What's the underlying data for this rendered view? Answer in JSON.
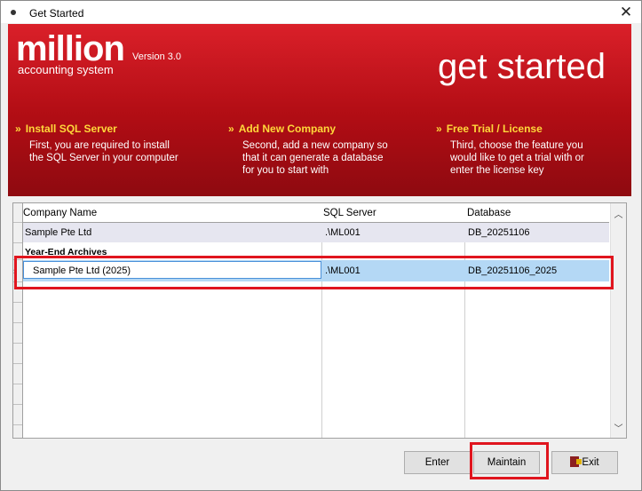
{
  "window": {
    "title": "Get Started",
    "close_glyph": "✕"
  },
  "banner": {
    "logo": "million",
    "logo_sub": "accounting system",
    "version": "Version 3.0",
    "tagline": "get started",
    "steps": [
      {
        "title": "Install SQL Server",
        "desc": "First, you are required to install\nthe SQL Server in your computer"
      },
      {
        "title": "Add New Company",
        "desc": "Second, add a new company so\nthat it can generate a database\nfor you to start with"
      },
      {
        "title": "Free Trial / License",
        "desc": "Third, choose the feature you\nwould like to get a trial with or\nenter the license key"
      }
    ],
    "chevron": "»"
  },
  "grid": {
    "columns": [
      "Company Name",
      "SQL Server",
      "Database"
    ],
    "rows": [
      {
        "company": "Sample Pte Ltd",
        "server": ".\\ML001",
        "database": "DB_20251106"
      }
    ],
    "group_label": "Year-End Archives",
    "archive_rows": [
      {
        "company": "Sample Pte Ltd (2025)",
        "server": ".\\ML001",
        "database": "DB_20251106_2025"
      }
    ]
  },
  "buttons": {
    "enter": "Enter",
    "maintain": "Maintain",
    "exit": "Exit"
  },
  "colors": {
    "banner_red": "#c0101a",
    "accent_yellow": "#ffd83a",
    "highlight_box": "#e0151e",
    "selection": "#b4d8f5"
  }
}
